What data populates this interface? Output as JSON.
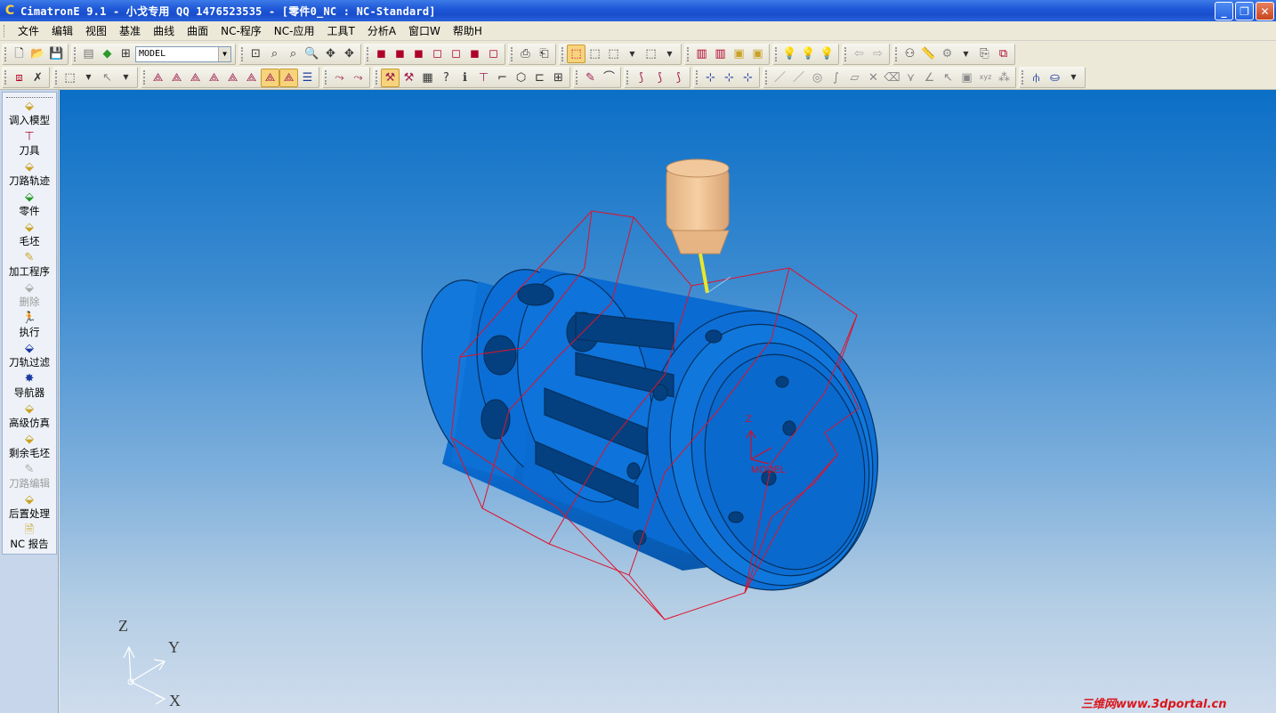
{
  "window": {
    "title": "CimatronE 9.1 - 小戈专用 QQ 1476523535 - [零件0_NC : NC-Standard]",
    "minimize": "_",
    "restore": "❐",
    "close": "✕"
  },
  "menu": {
    "items": [
      "文件",
      "编辑",
      "视图",
      "基准",
      "曲线",
      "曲面",
      "NC-程序",
      "NC-应用",
      "工具T",
      "分析A",
      "窗口W",
      "帮助H"
    ]
  },
  "toolbar": {
    "model_combo_value": "MODEL"
  },
  "left_panel": {
    "items": [
      {
        "label": "调入模型",
        "icon": "load-model-icon",
        "enabled": true
      },
      {
        "label": "刀具",
        "icon": "tool-icon",
        "enabled": true
      },
      {
        "label": "刀路轨迹",
        "icon": "toolpath-icon",
        "enabled": true
      },
      {
        "label": "零件",
        "icon": "part-icon",
        "enabled": true
      },
      {
        "label": "毛坯",
        "icon": "stock-icon",
        "enabled": true
      },
      {
        "label": "加工程序",
        "icon": "procedure-icon",
        "enabled": true
      },
      {
        "label": "删除",
        "icon": "delete-icon",
        "enabled": false
      },
      {
        "label": "执行",
        "icon": "execute-icon",
        "enabled": true
      },
      {
        "label": "刀轨过滤",
        "icon": "filter-icon",
        "enabled": true
      },
      {
        "label": "导航器",
        "icon": "navigator-icon",
        "enabled": true
      },
      {
        "label": "高级仿真",
        "icon": "simulation-icon",
        "enabled": true
      },
      {
        "label": "剩余毛坯",
        "icon": "remaining-stock-icon",
        "enabled": true
      },
      {
        "label": "刀路编辑",
        "icon": "toolpath-edit-icon",
        "enabled": false
      },
      {
        "label": "后置处理",
        "icon": "post-process-icon",
        "enabled": true
      },
      {
        "label": "NC 报告",
        "icon": "nc-report-icon",
        "enabled": true
      }
    ]
  },
  "viewport": {
    "triad": {
      "x": "X",
      "y": "Y",
      "z": "Z"
    },
    "model_ucs": {
      "z": "Z",
      "label": "MODEL"
    },
    "watermark": "三维网www.3dportal.cn"
  }
}
